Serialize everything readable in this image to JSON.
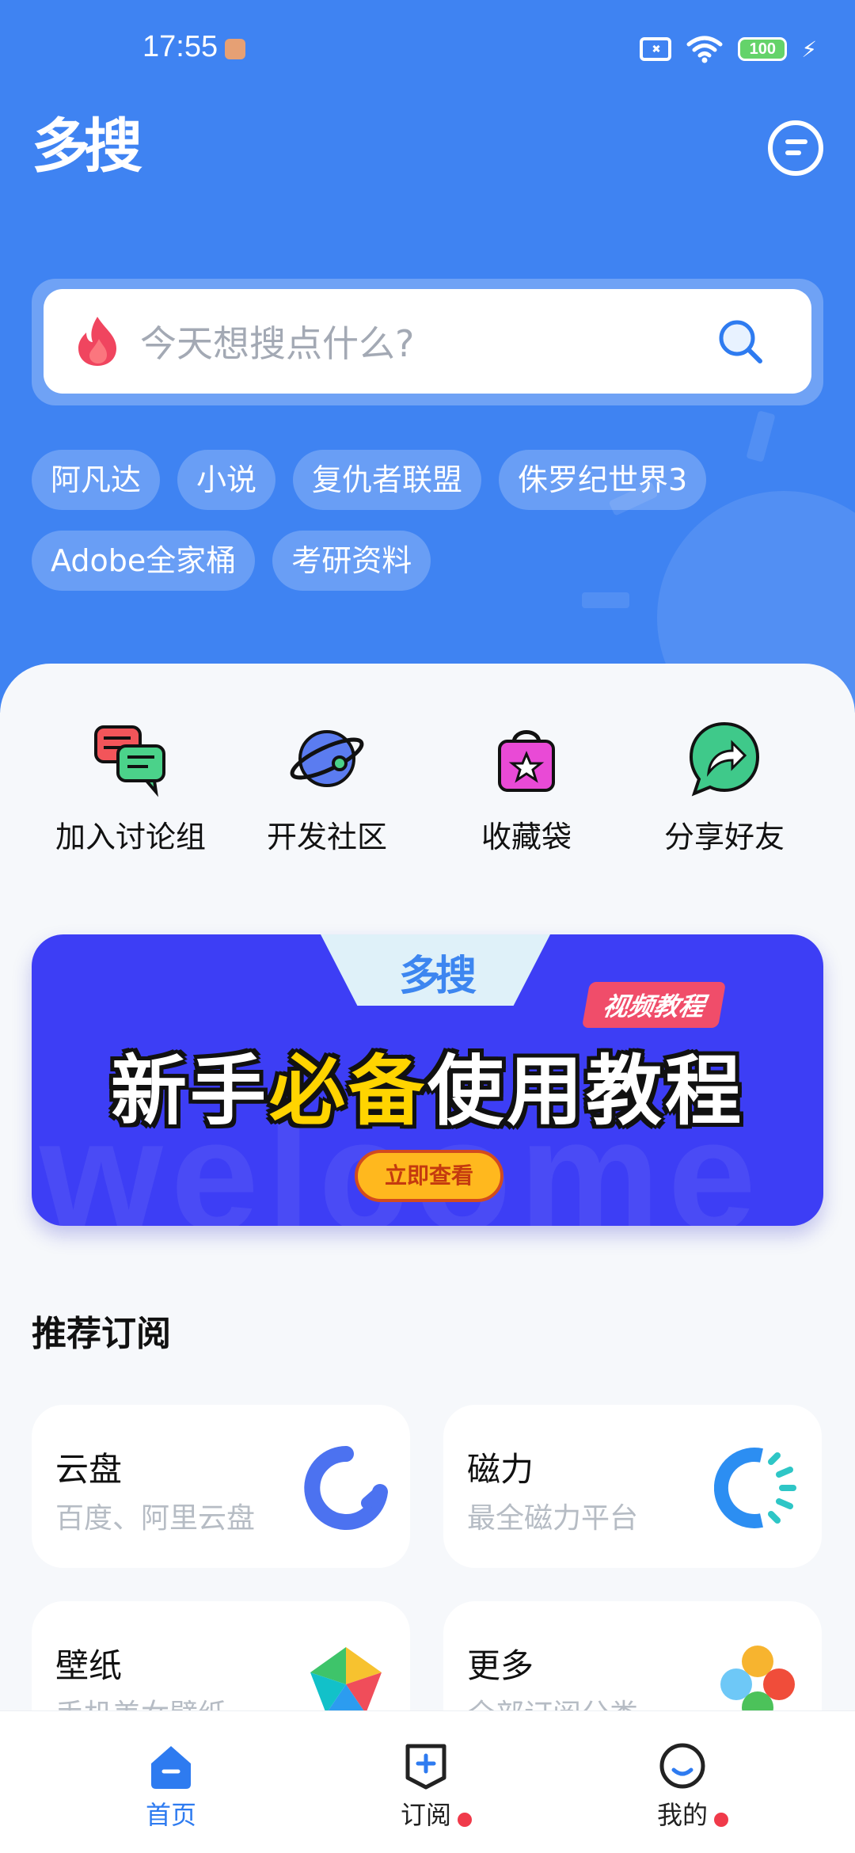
{
  "status_bar": {
    "time": "17:55",
    "battery": "100"
  },
  "header": {
    "logo_text": "多搜"
  },
  "search": {
    "placeholder": "今天想搜点什么?"
  },
  "hot_tags": [
    "阿凡达",
    "小说",
    "复仇者联盟",
    "侏罗纪世界3",
    "Adobe全家桶",
    "考研资料"
  ],
  "quick_links": [
    {
      "label": "加入讨论组",
      "icon": "chat-bubbles-icon"
    },
    {
      "label": "开发社区",
      "icon": "planet-icon"
    },
    {
      "label": "收藏袋",
      "icon": "shopping-bag-star-icon"
    },
    {
      "label": "分享好友",
      "icon": "share-arrow-icon"
    }
  ],
  "banner": {
    "logo_text": "多搜",
    "badge": "视频教程",
    "title_part1": "新手",
    "title_highlight": "必备",
    "title_part2": "使用教程",
    "button": "立即查看",
    "watermark": "welcome"
  },
  "recommend": {
    "title": "推荐订阅",
    "cards": [
      {
        "title": "云盘",
        "desc": "百度、阿里云盘",
        "icon": "cloud-ring-icon"
      },
      {
        "title": "磁力",
        "desc": "最全磁力平台",
        "icon": "magnet-ring-icon"
      },
      {
        "title": "壁纸",
        "desc": "手机美女壁纸",
        "icon": "colorful-pinwheel-icon"
      },
      {
        "title": "更多",
        "desc": "全部订阅分类",
        "icon": "colorful-dots-icon"
      }
    ]
  },
  "tab_bar": {
    "items": [
      {
        "label": "首页",
        "icon": "home-icon",
        "active": true
      },
      {
        "label": "订阅",
        "icon": "subscribe-icon",
        "active": false
      },
      {
        "label": "我的",
        "icon": "profile-icon",
        "active": false
      }
    ]
  },
  "colors": {
    "brand_blue": "#3f83f2",
    "banner_blue": "#3d3ef5",
    "highlight_yellow": "#ffd400",
    "alert_red": "#f03a4a"
  }
}
